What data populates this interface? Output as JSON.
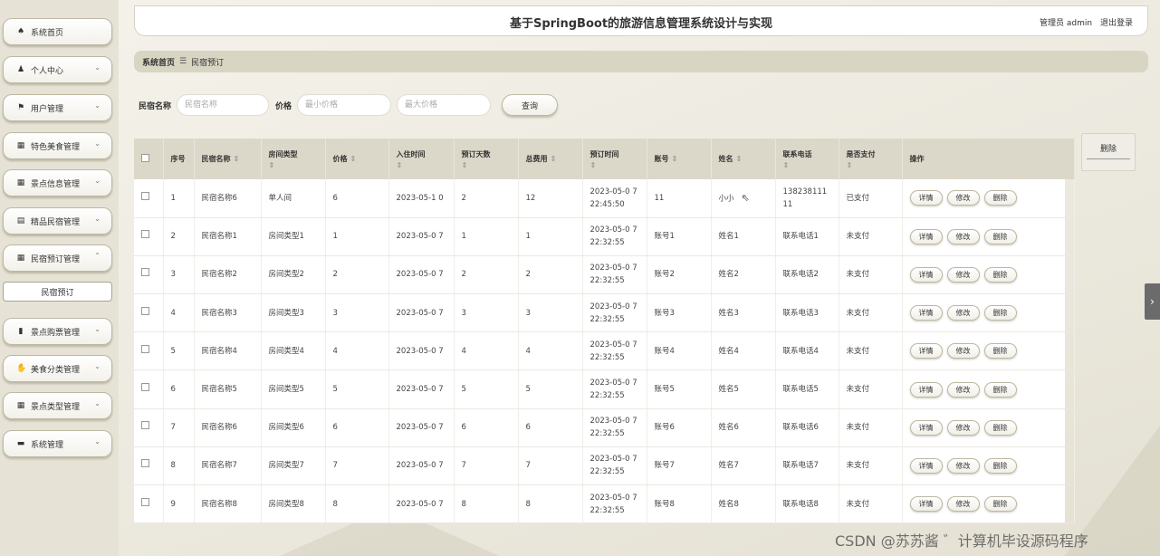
{
  "header": {
    "title": "基于SpringBoot的旅游信息管理系统设计与实现",
    "user": "管理员 admin",
    "logout": "退出登录"
  },
  "sidebar": {
    "items": [
      {
        "label": "系统首页",
        "icon": "home-icon",
        "glyph": "♠",
        "chevron": ""
      },
      {
        "label": "个人中心",
        "icon": "user-icon",
        "glyph": "♟",
        "chevron": "⌄"
      },
      {
        "label": "用户管理",
        "icon": "flag-icon",
        "glyph": "⚑",
        "chevron": "⌄"
      },
      {
        "label": "特色美食管理",
        "icon": "grid-icon",
        "glyph": "▦",
        "chevron": "⌄"
      },
      {
        "label": "景点信息管理",
        "icon": "grid-icon",
        "glyph": "▦",
        "chevron": "⌄"
      },
      {
        "label": "精品民宿管理",
        "icon": "document-icon",
        "glyph": "▤",
        "chevron": "⌄"
      },
      {
        "label": "民宿预订管理",
        "icon": "grid-icon",
        "glyph": "▦",
        "chevron": "⌃"
      },
      {
        "label": "景点购票管理",
        "icon": "bar-chart-icon",
        "glyph": "▮",
        "chevron": "⌄"
      },
      {
        "label": "美食分类管理",
        "icon": "thumb-icon",
        "glyph": "✋",
        "chevron": "⌄"
      },
      {
        "label": "景点类型管理",
        "icon": "grid-icon",
        "glyph": "▦",
        "chevron": "⌄"
      },
      {
        "label": "系统管理",
        "icon": "server-icon",
        "glyph": "▬",
        "chevron": "⌄"
      }
    ],
    "sub_item": "民宿预订"
  },
  "breadcrumb": {
    "home": "系统首页",
    "separator": "☰",
    "current": "民宿预订"
  },
  "search": {
    "name_label": "民宿名称",
    "name_placeholder": "民宿名称",
    "price_label": "价格",
    "min_placeholder": "最小价格",
    "max_placeholder": "最大价格",
    "query_button": "查询"
  },
  "delete_button": "删除",
  "table": {
    "sort_glyph": "⇕",
    "headers": {
      "index": "序号",
      "name": "民宿名称",
      "room_type": "房间类型",
      "price": "价格",
      "checkin": "入住时间",
      "days": "预订天数",
      "total": "总费用",
      "booking_time": "预订时间",
      "account": "账号",
      "user_name": "姓名",
      "phone": "联系电话",
      "paid": "是否支付",
      "ops": "操作"
    },
    "rows": [
      {
        "index": "1",
        "name": "民宿名称6",
        "room_type": "单人间",
        "price": "6",
        "checkin": "2023-05-1 0",
        "days": "2",
        "total": "12",
        "booking_time": "2023-05-0 7 22:45:50",
        "account": "11",
        "user_name": "小小",
        "phone": "138238111 11",
        "paid": "已支付"
      },
      {
        "index": "2",
        "name": "民宿名称1",
        "room_type": "房间类型1",
        "price": "1",
        "checkin": "2023-05-0 7",
        "days": "1",
        "total": "1",
        "booking_time": "2023-05-0 7 22:32:55",
        "account": "账号1",
        "user_name": "姓名1",
        "phone": "联系电话1",
        "paid": "未支付"
      },
      {
        "index": "3",
        "name": "民宿名称2",
        "room_type": "房间类型2",
        "price": "2",
        "checkin": "2023-05-0 7",
        "days": "2",
        "total": "2",
        "booking_time": "2023-05-0 7 22:32:55",
        "account": "账号2",
        "user_name": "姓名2",
        "phone": "联系电话2",
        "paid": "未支付"
      },
      {
        "index": "4",
        "name": "民宿名称3",
        "room_type": "房间类型3",
        "price": "3",
        "checkin": "2023-05-0 7",
        "days": "3",
        "total": "3",
        "booking_time": "2023-05-0 7 22:32:55",
        "account": "账号3",
        "user_name": "姓名3",
        "phone": "联系电话3",
        "paid": "未支付"
      },
      {
        "index": "5",
        "name": "民宿名称4",
        "room_type": "房间类型4",
        "price": "4",
        "checkin": "2023-05-0 7",
        "days": "4",
        "total": "4",
        "booking_time": "2023-05-0 7 22:32:55",
        "account": "账号4",
        "user_name": "姓名4",
        "phone": "联系电话4",
        "paid": "未支付"
      },
      {
        "index": "6",
        "name": "民宿名称5",
        "room_type": "房间类型5",
        "price": "5",
        "checkin": "2023-05-0 7",
        "days": "5",
        "total": "5",
        "booking_time": "2023-05-0 7 22:32:55",
        "account": "账号5",
        "user_name": "姓名5",
        "phone": "联系电话5",
        "paid": "未支付"
      },
      {
        "index": "7",
        "name": "民宿名称6",
        "room_type": "房间类型6",
        "price": "6",
        "checkin": "2023-05-0 7",
        "days": "6",
        "total": "6",
        "booking_time": "2023-05-0 7 22:32:55",
        "account": "账号6",
        "user_name": "姓名6",
        "phone": "联系电话6",
        "paid": "未支付"
      },
      {
        "index": "8",
        "name": "民宿名称7",
        "room_type": "房间类型7",
        "price": "7",
        "checkin": "2023-05-0 7",
        "days": "7",
        "total": "7",
        "booking_time": "2023-05-0 7 22:32:55",
        "account": "账号7",
        "user_name": "姓名7",
        "phone": "联系电话7",
        "paid": "未支付"
      },
      {
        "index": "9",
        "name": "民宿名称8",
        "room_type": "房间类型8",
        "price": "8",
        "checkin": "2023-05-0 7",
        "days": "8",
        "total": "8",
        "booking_time": "2023-05-0 7 22:32:55",
        "account": "账号8",
        "user_name": "姓名8",
        "phone": "联系电话8",
        "paid": "未支付"
      }
    ],
    "actions": {
      "detail": "详情",
      "edit": "修改",
      "delete": "删除"
    }
  },
  "watermark": "CSDN @苏苏酱 ゛计算机毕设源码程序",
  "edge_arrow_glyph": "›"
}
